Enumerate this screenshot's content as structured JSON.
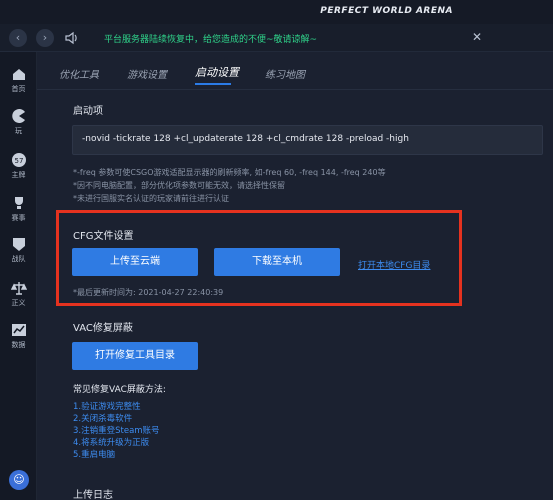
{
  "window": {
    "brand": "PERFECT WORLD ARENA"
  },
  "navbar": {
    "back_icon": "chevron-left-icon",
    "forward_icon": "chevron-right-icon",
    "notice": "平台服务器陆续恢复中，给您造成的不便~敬请谅解~",
    "close_icon": "close-icon"
  },
  "sidebar": {
    "items": [
      {
        "label": "首页",
        "icon": "home-icon"
      },
      {
        "label": "玩",
        "icon": "pacman-icon"
      },
      {
        "label": "主牌",
        "icon": "badge-icon"
      },
      {
        "label": "赛事",
        "icon": "trophy-icon"
      },
      {
        "label": "战队",
        "icon": "team-icon"
      },
      {
        "label": "正义",
        "icon": "scale-icon"
      },
      {
        "label": "数据",
        "icon": "chart-icon"
      }
    ]
  },
  "tabs": [
    {
      "label": "优化工具"
    },
    {
      "label": "游戏设置"
    },
    {
      "label": "启动设置",
      "active": true
    },
    {
      "label": "练习地图"
    }
  ],
  "launch": {
    "title": "启动项",
    "value": "-novid -tickrate 128 +cl_updaterate 128 +cl_cmdrate 128 -preload -high",
    "notes": [
      "*-freq 参数可使CSGO游戏适配显示器的刷新频率, 如-freq 60, -freq 144, -freq 240等",
      "*因不同电脑配置，部分优化项参数可能无效，请选择性保留",
      "*未进行国服实名认证的玩家请前往进行认证"
    ]
  },
  "cfg": {
    "title": "CFG文件设置",
    "upload_label": "上传至云端",
    "download_label": "下载至本机",
    "open_link": "打开本地CFG目录",
    "last_update": "*最后更新时间为: 2021-04-27 22:40:39"
  },
  "vac": {
    "title": "VAC修复屏蔽",
    "fix_button": "打开修复工具目录",
    "methods_title": "常见修复VAC屏蔽方法:",
    "methods": [
      "1.验证游戏完整性",
      "2.关闭杀毒软件",
      "3.注销重登Steam账号",
      "4.将系统升级为正版",
      "5.重启电脑"
    ]
  },
  "upload_log": {
    "title": "上传日志"
  },
  "colors": {
    "accent": "#2f7be3",
    "highlight_frame": "#e5321f",
    "notice_text": "#2fd38a"
  }
}
